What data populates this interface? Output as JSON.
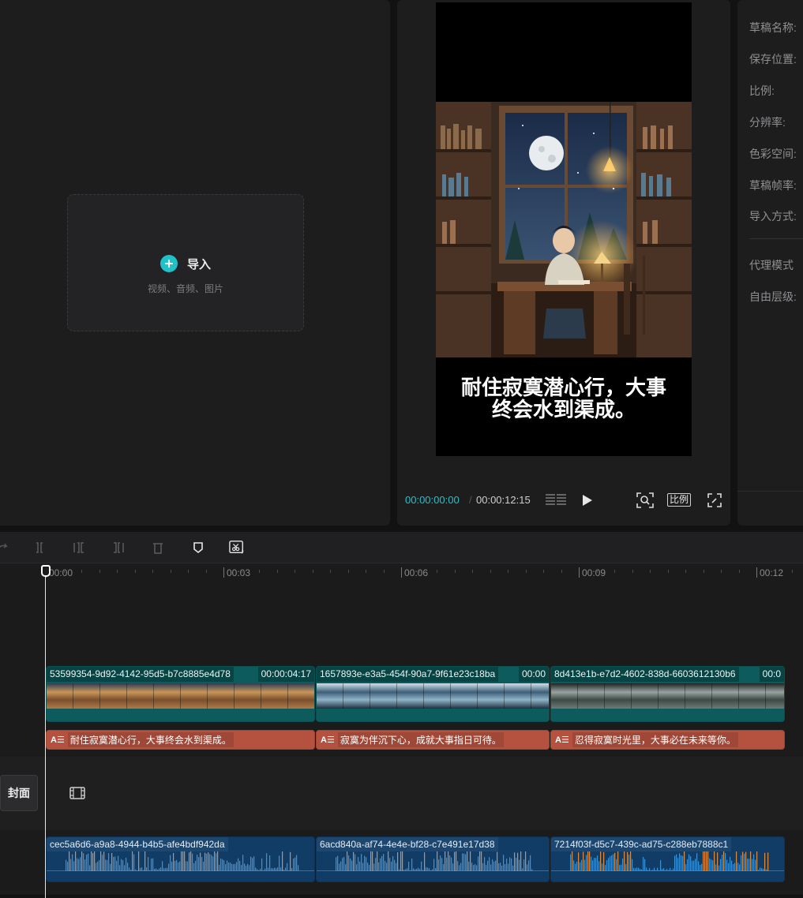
{
  "media_panel": {
    "import_label": "导入",
    "import_hint": "视频、音频、图片"
  },
  "player": {
    "caption": "耐住寂寞潜心行，大事终会水到渠成。",
    "time_current": "00:00:00:00",
    "time_sep": "/",
    "time_total": "00:00:12:15",
    "ratio_label": "比例",
    "accent": "#21c3ce"
  },
  "details": {
    "props": [
      "草稿名称:",
      "保存位置:",
      "比例:",
      "分辨率:",
      "色彩空间:",
      "草稿帧率:",
      "导入方式:"
    ],
    "props2": [
      "代理模式",
      "自由层级:"
    ]
  },
  "timeline": {
    "ruler_labels": [
      "00:00",
      "00:03",
      "00:06",
      "00:09",
      "00:12"
    ],
    "cover_label": "封面",
    "video_clips": [
      {
        "name": "53599354-9d92-4142-95d5-b7c8885e4d78",
        "duration": "00:00:04:17"
      },
      {
        "name": "1657893e-e3a5-454f-90a7-9f61e23c18ba",
        "duration": "00:00"
      },
      {
        "name": "8d413e1b-e7d2-4602-838d-6603612130b6",
        "duration": "00:0"
      }
    ],
    "text_clips": [
      {
        "tag": "A☰",
        "text": "耐住寂寞潜心行，大事终会水到渠成。"
      },
      {
        "tag": "A☰",
        "text": "寂寞为伴沉下心，成就大事指日可待。"
      },
      {
        "tag": "A☰",
        "text": "忍得寂寞时光里，大事必在未来等你。"
      }
    ],
    "audio_clips": [
      {
        "name": "cec5a6d6-a9a8-4944-b4b5-afe4bdf942da"
      },
      {
        "name": "6acd840a-af74-4e4e-bf28-c7e491e17d38"
      },
      {
        "name": "7214f03f-d5c7-439c-ad75-c288eb7888c1"
      }
    ]
  }
}
